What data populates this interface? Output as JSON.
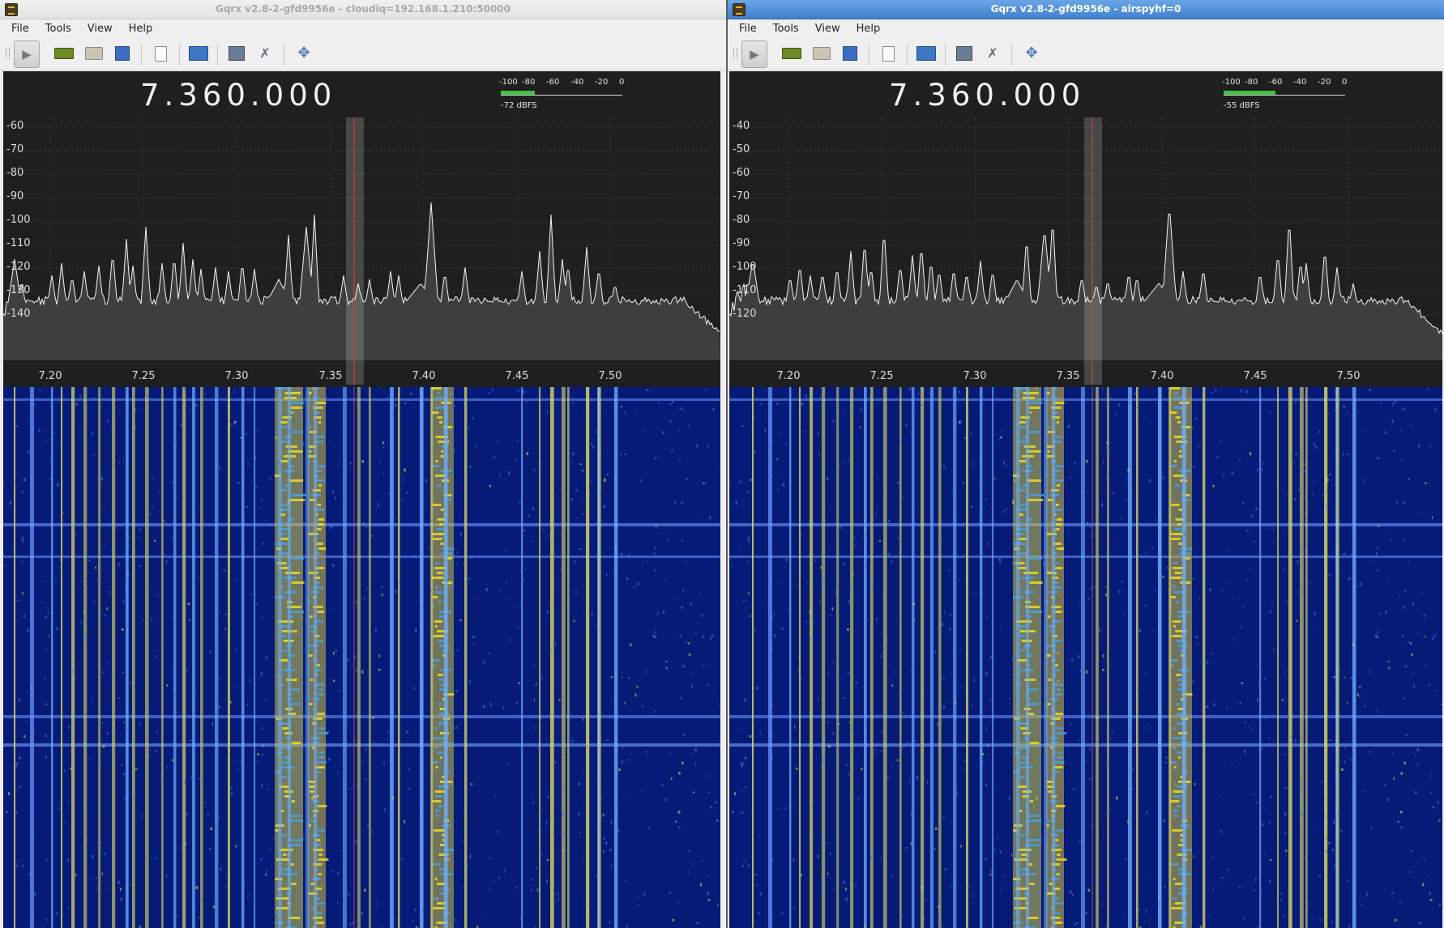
{
  "windows": [
    {
      "title": "Gqrx v2.8-2-gfd9956e - cloudiq=192.168.1.210:50000",
      "active": false,
      "menu": [
        "File",
        "Tools",
        "View",
        "Help"
      ],
      "toolbar": [
        "play-icon",
        "hardware-icon",
        "folder-icon",
        "save-icon",
        "doc-icon",
        "scope-icon",
        "network-icon",
        "tools-icon",
        "move-icon"
      ],
      "frequency": "7.360.000",
      "meter": {
        "labels": [
          "-100",
          "-80",
          "-60",
          "-40",
          "-20",
          "0"
        ],
        "level_dbfs": -72,
        "readout": "-72 dBFS",
        "color": "#3cc23c"
      },
      "spectrum": {
        "ylabels": [
          "-60",
          "-70",
          "-80",
          "-90",
          "-100",
          "-110",
          "-120",
          "-130",
          "-140"
        ],
        "xlabels": [
          "7.20",
          "7.25",
          "7.30",
          "7.35",
          "7.40",
          "7.45",
          "7.50"
        ],
        "ymax": -55,
        "ymin": -143
      }
    },
    {
      "title": "Gqrx v2.8-2-gfd9956e - airspyhf=0",
      "active": true,
      "menu": [
        "File",
        "Tools",
        "View",
        "Help"
      ],
      "toolbar": [
        "play-icon",
        "hardware-icon",
        "folder-icon",
        "save-icon",
        "doc-icon",
        "scope-icon",
        "network-icon",
        "tools-icon",
        "move-icon"
      ],
      "frequency": "7.360.000",
      "meter": {
        "labels": [
          "-100",
          "-80",
          "-60",
          "-40",
          "-20",
          "0"
        ],
        "level_dbfs": -55,
        "readout": "-55 dBFS",
        "color": "#3cc23c"
      },
      "spectrum": {
        "ylabels": [
          "-40",
          "-50",
          "-60",
          "-70",
          "-80",
          "-90",
          "-100",
          "-110",
          "-120"
        ],
        "xlabels": [
          "7.20",
          "7.25",
          "7.30",
          "7.35",
          "7.40",
          "7.45",
          "7.50"
        ],
        "ymax": -35,
        "ymin": -123
      }
    }
  ]
}
